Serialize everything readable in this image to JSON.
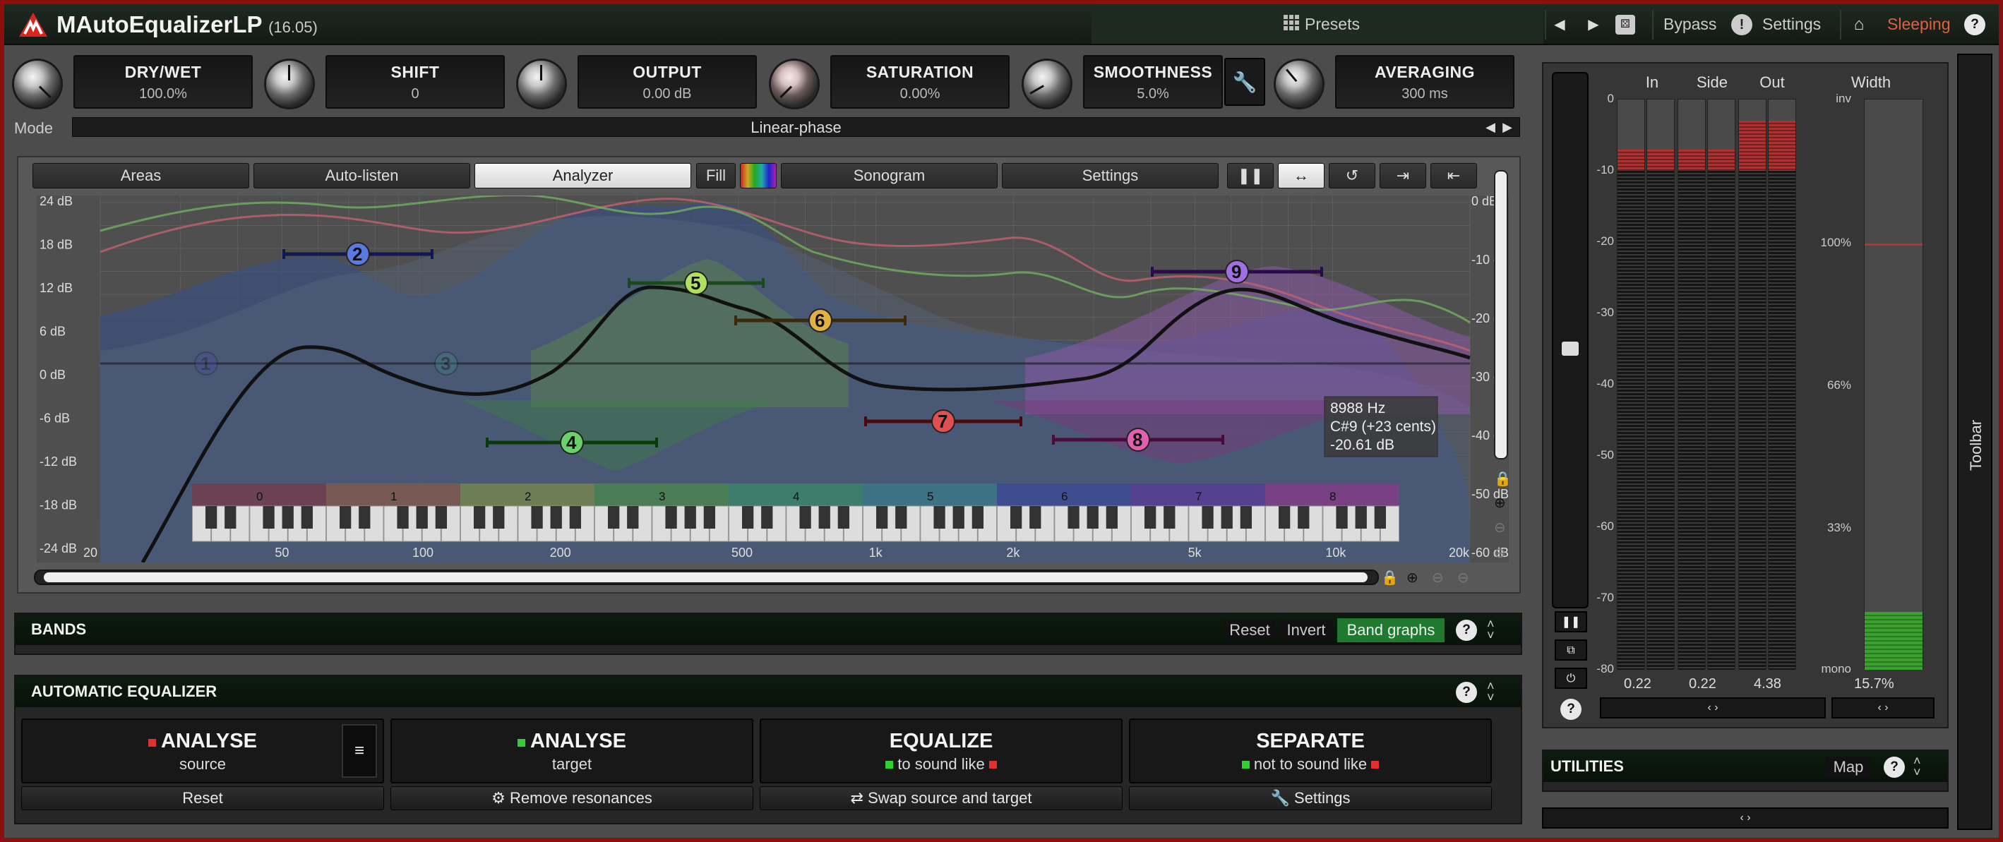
{
  "app": {
    "name": "MAutoEqualizerLP",
    "version": "(16.05)",
    "presets": "Presets",
    "bypass": "Bypass",
    "settings": "Settings",
    "sleeping": "Sleeping",
    "help": "?"
  },
  "knobs": [
    {
      "name": "DRY/WET",
      "value": "100.0%"
    },
    {
      "name": "SHIFT",
      "value": "0"
    },
    {
      "name": "OUTPUT",
      "value": "0.00 dB"
    },
    {
      "name": "SATURATION",
      "value": "0.00%"
    },
    {
      "name": "SMOOTHNESS",
      "value": "5.0%"
    },
    {
      "name": "AVERAGING",
      "value": "300 ms"
    }
  ],
  "mode": {
    "label": "Mode",
    "value": "Linear-phase"
  },
  "eq_tabs": {
    "areas": "Areas",
    "autolisten": "Auto-listen",
    "analyzer": "Analyzer",
    "fill": "Fill",
    "sonogram": "Sonogram",
    "settings": "Settings"
  },
  "graph": {
    "left_axis": [
      "24 dB",
      "18 dB",
      "12 dB",
      "6 dB",
      "0 dB",
      "-6 dB",
      "-12 dB",
      "-18 dB",
      "-24 dB"
    ],
    "right_axis": [
      "0 dB",
      "-10 dB",
      "-20 dB",
      "-30 dB",
      "-40 dB",
      "-50 dB",
      "-60 dB"
    ],
    "freq_axis": [
      "20",
      "50",
      "100",
      "200",
      "500",
      "1k",
      "2k",
      "5k",
      "10k",
      "20k"
    ],
    "octaves": [
      "0",
      "1",
      "2",
      "3",
      "4",
      "5",
      "6",
      "7",
      "8"
    ],
    "bands": [
      "1",
      "2",
      "3",
      "4",
      "5",
      "6",
      "7",
      "8",
      "9"
    ],
    "tooltip": {
      "freq": "8988 Hz",
      "note": "C#9 (+23 cents)",
      "level": "-20.61 dB"
    }
  },
  "bands_panel": {
    "title": "BANDS",
    "reset": "Reset",
    "invert": "Invert",
    "band_graphs": "Band graphs"
  },
  "auto_eq": {
    "title": "AUTOMATIC EQUALIZER",
    "analyse_source": {
      "title": "ANALYSE",
      "sub": "source"
    },
    "analyse_target": {
      "title": "ANALYSE",
      "sub": "target"
    },
    "equalize": {
      "title": "EQUALIZE",
      "sub": "to sound like"
    },
    "separate": {
      "title": "SEPARATE",
      "sub": "not to sound like"
    },
    "menu": "≡",
    "reset": "Reset",
    "remove_res": "Remove resonances",
    "swap": "Swap source and target",
    "settings": "Settings"
  },
  "meters": {
    "in": "In",
    "side": "Side",
    "out": "Out",
    "width": "Width",
    "scale": [
      "0",
      "-10",
      "-20",
      "-30",
      "-40",
      "-50",
      "-60",
      "-70",
      "-80"
    ],
    "width_scale": [
      "inv",
      "100%",
      "66%",
      "33%",
      "mono"
    ],
    "in_val": "0.22",
    "side_val": "0.22",
    "out_val": "4.38",
    "width_val": "15.7%",
    "levels_db": {
      "in": -7,
      "side": -7,
      "out": -3
    },
    "width_level": 0.157
  },
  "utilities": {
    "title": "UTILITIES",
    "map": "Map"
  },
  "toolbar": "Toolbar",
  "colors": {
    "accent_green": "#1f7a2f",
    "sleeping": "#e06040",
    "logo": "#d8261e"
  }
}
